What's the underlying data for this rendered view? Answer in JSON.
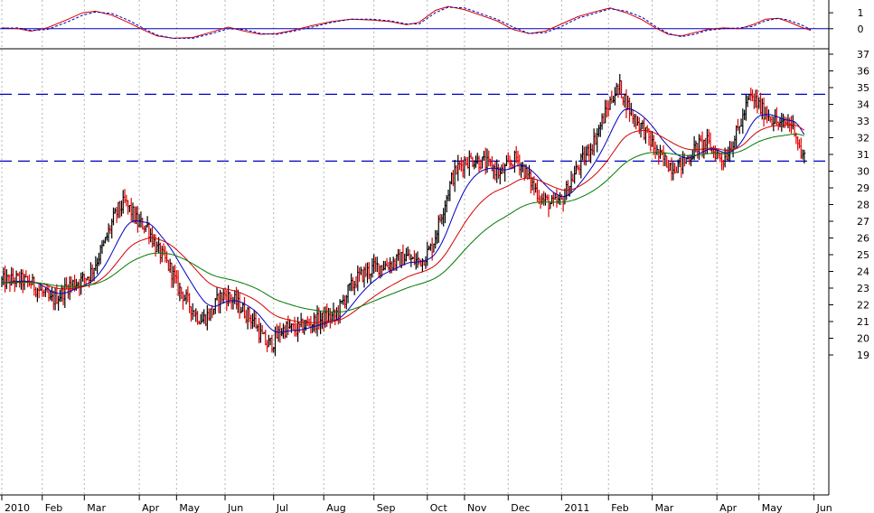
{
  "chart_data": [
    {
      "type": "line",
      "panel": "oscillator",
      "ylim": [
        -1.2,
        1.8
      ],
      "y_ticks": [
        "1",
        "0"
      ],
      "y_tick_values": [
        1,
        0
      ],
      "series": [
        {
          "color": "#d40000",
          "style": "solid",
          "points": [
            [
              0,
              0.05
            ],
            [
              10,
              0.0
            ],
            [
              18,
              -0.15
            ],
            [
              28,
              0.05
            ],
            [
              40,
              0.55
            ],
            [
              50,
              1.0
            ],
            [
              58,
              1.1
            ],
            [
              68,
              0.85
            ],
            [
              78,
              0.4
            ],
            [
              88,
              -0.1
            ],
            [
              96,
              -0.45
            ],
            [
              106,
              -0.6
            ],
            [
              118,
              -0.55
            ],
            [
              130,
              -0.2
            ],
            [
              140,
              0.1
            ],
            [
              150,
              -0.15
            ],
            [
              160,
              -0.35
            ],
            [
              170,
              -0.3
            ],
            [
              180,
              -0.1
            ],
            [
              192,
              0.2
            ],
            [
              204,
              0.45
            ],
            [
              216,
              0.6
            ],
            [
              228,
              0.55
            ],
            [
              240,
              0.45
            ],
            [
              250,
              0.25
            ],
            [
              258,
              0.4
            ],
            [
              268,
              1.15
            ],
            [
              276,
              1.4
            ],
            [
              286,
              1.2
            ],
            [
              296,
              0.85
            ],
            [
              306,
              0.5
            ],
            [
              316,
              -0.05
            ],
            [
              326,
              -0.3
            ],
            [
              336,
              -0.15
            ],
            [
              346,
              0.3
            ],
            [
              356,
              0.75
            ],
            [
              366,
              1.05
            ],
            [
              376,
              1.3
            ],
            [
              386,
              1.0
            ],
            [
              396,
              0.55
            ],
            [
              404,
              0.05
            ],
            [
              412,
              -0.35
            ],
            [
              420,
              -0.45
            ],
            [
              428,
              -0.25
            ],
            [
              436,
              -0.05
            ],
            [
              446,
              0.05
            ],
            [
              456,
              0.0
            ],
            [
              464,
              0.25
            ],
            [
              472,
              0.6
            ],
            [
              480,
              0.65
            ],
            [
              486,
              0.45
            ],
            [
              494,
              0.1
            ],
            [
              500,
              -0.1
            ]
          ]
        },
        {
          "color": "#0000c0",
          "style": "dashed",
          "points": [
            [
              0,
              0.02
            ],
            [
              10,
              0.05
            ],
            [
              18,
              -0.1
            ],
            [
              28,
              -0.05
            ],
            [
              40,
              0.4
            ],
            [
              50,
              0.85
            ],
            [
              58,
              1.05
            ],
            [
              68,
              0.95
            ],
            [
              78,
              0.55
            ],
            [
              88,
              0.0
            ],
            [
              96,
              -0.4
            ],
            [
              106,
              -0.6
            ],
            [
              118,
              -0.6
            ],
            [
              130,
              -0.3
            ],
            [
              140,
              0.0
            ],
            [
              150,
              -0.05
            ],
            [
              160,
              -0.3
            ],
            [
              170,
              -0.35
            ],
            [
              180,
              -0.15
            ],
            [
              192,
              0.1
            ],
            [
              204,
              0.4
            ],
            [
              216,
              0.6
            ],
            [
              228,
              0.6
            ],
            [
              240,
              0.5
            ],
            [
              250,
              0.3
            ],
            [
              258,
              0.3
            ],
            [
              268,
              1.0
            ],
            [
              276,
              1.35
            ],
            [
              286,
              1.3
            ],
            [
              296,
              0.95
            ],
            [
              306,
              0.6
            ],
            [
              316,
              0.1
            ],
            [
              326,
              -0.3
            ],
            [
              336,
              -0.25
            ],
            [
              346,
              0.15
            ],
            [
              356,
              0.65
            ],
            [
              366,
              0.95
            ],
            [
              376,
              1.25
            ],
            [
              386,
              1.1
            ],
            [
              396,
              0.7
            ],
            [
              404,
              0.15
            ],
            [
              412,
              -0.3
            ],
            [
              420,
              -0.5
            ],
            [
              428,
              -0.35
            ],
            [
              436,
              -0.1
            ],
            [
              446,
              0.0
            ],
            [
              456,
              0.05
            ],
            [
              464,
              0.15
            ],
            [
              472,
              0.5
            ],
            [
              480,
              0.65
            ],
            [
              486,
              0.55
            ],
            [
              494,
              0.25
            ],
            [
              500,
              -0.05
            ]
          ]
        }
      ],
      "reference_line": 0
    },
    {
      "type": "line",
      "panel": "price",
      "ylim": [
        18,
        37.5
      ],
      "y_ticks": [
        "37",
        "36",
        "35",
        "34",
        "33",
        "32",
        "31",
        "30",
        "29",
        "28",
        "27",
        "26",
        "25",
        "24",
        "23",
        "22",
        "21",
        "20",
        "19"
      ],
      "y_tick_values": [
        37,
        36,
        35,
        34,
        33,
        32,
        31,
        30,
        29,
        28,
        27,
        26,
        25,
        24,
        23,
        22,
        21,
        20,
        19
      ],
      "x_unit": "trading days from start of Jan 2010",
      "x_ticks": [
        "2010",
        "Feb",
        "Mar",
        "Apr",
        "May",
        "Jun",
        "Jul",
        "Aug",
        "Sep",
        "Oct",
        "Nov",
        "Dec",
        "2011",
        "Feb",
        "Mar",
        "Apr",
        "May",
        "Jun"
      ],
      "x_tick_values": [
        0,
        25,
        51,
        85,
        108,
        138,
        168,
        199,
        230,
        263,
        286,
        313,
        346,
        375,
        402,
        442,
        468,
        502
      ],
      "horizontal_levels": [
        34.6,
        30.6
      ],
      "price_path": [
        [
          0,
          23.4
        ],
        [
          10,
          23.5
        ],
        [
          18,
          23.3
        ],
        [
          24,
          22.8
        ],
        [
          30,
          22.2
        ],
        [
          36,
          22.6
        ],
        [
          42,
          23.2
        ],
        [
          48,
          23.4
        ],
        [
          54,
          23.8
        ],
        [
          58,
          24.5
        ],
        [
          64,
          25.8
        ],
        [
          68,
          26.9
        ],
        [
          72,
          27.7
        ],
        [
          76,
          28.1
        ],
        [
          80,
          27.6
        ],
        [
          84,
          26.9
        ],
        [
          90,
          26.7
        ],
        [
          96,
          25.3
        ],
        [
          100,
          24.8
        ],
        [
          105,
          24.0
        ],
        [
          108,
          23.2
        ],
        [
          112,
          22.6
        ],
        [
          116,
          22.0
        ],
        [
          120,
          21.4
        ],
        [
          124,
          21.1
        ],
        [
          130,
          21.6
        ],
        [
          134,
          22.4
        ],
        [
          138,
          22.6
        ],
        [
          144,
          22.2
        ],
        [
          150,
          21.6
        ],
        [
          156,
          21.0
        ],
        [
          160,
          20.2
        ],
        [
          164,
          19.6
        ],
        [
          168,
          19.8
        ],
        [
          172,
          20.4
        ],
        [
          176,
          20.6
        ],
        [
          182,
          20.5
        ],
        [
          188,
          20.8
        ],
        [
          194,
          21.0
        ],
        [
          200,
          21.2
        ],
        [
          206,
          21.3
        ],
        [
          210,
          22.0
        ],
        [
          214,
          22.8
        ],
        [
          220,
          23.6
        ],
        [
          226,
          24.0
        ],
        [
          232,
          24.3
        ],
        [
          238,
          24.4
        ],
        [
          244,
          24.6
        ],
        [
          250,
          24.9
        ],
        [
          254,
          24.6
        ],
        [
          260,
          24.7
        ],
        [
          266,
          25.5
        ],
        [
          272,
          27.5
        ],
        [
          278,
          29.5
        ],
        [
          282,
          30.2
        ],
        [
          286,
          30.6
        ],
        [
          292,
          30.7
        ],
        [
          298,
          30.5
        ],
        [
          304,
          30.2
        ],
        [
          308,
          29.8
        ],
        [
          314,
          30.4
        ],
        [
          318,
          30.8
        ],
        [
          322,
          30.2
        ],
        [
          328,
          29.2
        ],
        [
          334,
          28.3
        ],
        [
          340,
          28.0
        ],
        [
          346,
          28.2
        ],
        [
          350,
          29.0
        ],
        [
          356,
          30.2
        ],
        [
          360,
          30.8
        ],
        [
          366,
          31.8
        ],
        [
          372,
          33.2
        ],
        [
          378,
          34.6
        ],
        [
          382,
          35.0
        ],
        [
          386,
          34.1
        ],
        [
          390,
          33.3
        ],
        [
          396,
          32.6
        ],
        [
          402,
          31.6
        ],
        [
          406,
          30.9
        ],
        [
          410,
          30.6
        ],
        [
          414,
          30.3
        ],
        [
          420,
          30.4
        ],
        [
          426,
          31.0
        ],
        [
          430,
          31.5
        ],
        [
          436,
          31.7
        ],
        [
          440,
          31.2
        ],
        [
          446,
          30.7
        ],
        [
          450,
          31.4
        ],
        [
          454,
          32.2
        ],
        [
          458,
          33.2
        ],
        [
          462,
          34.4
        ],
        [
          466,
          34.2
        ],
        [
          470,
          33.6
        ],
        [
          474,
          33.4
        ],
        [
          478,
          33.0
        ],
        [
          482,
          32.7
        ],
        [
          486,
          33.0
        ],
        [
          490,
          32.6
        ],
        [
          492,
          31.8
        ],
        [
          494,
          31.0
        ],
        [
          496,
          30.8
        ]
      ],
      "series": [
        {
          "color": "#0000c0",
          "period": 20
        },
        {
          "color": "#d40000",
          "period": 50
        },
        {
          "color": "#007a00",
          "period": 100
        }
      ],
      "ma_initial_value": 23.3
    }
  ]
}
